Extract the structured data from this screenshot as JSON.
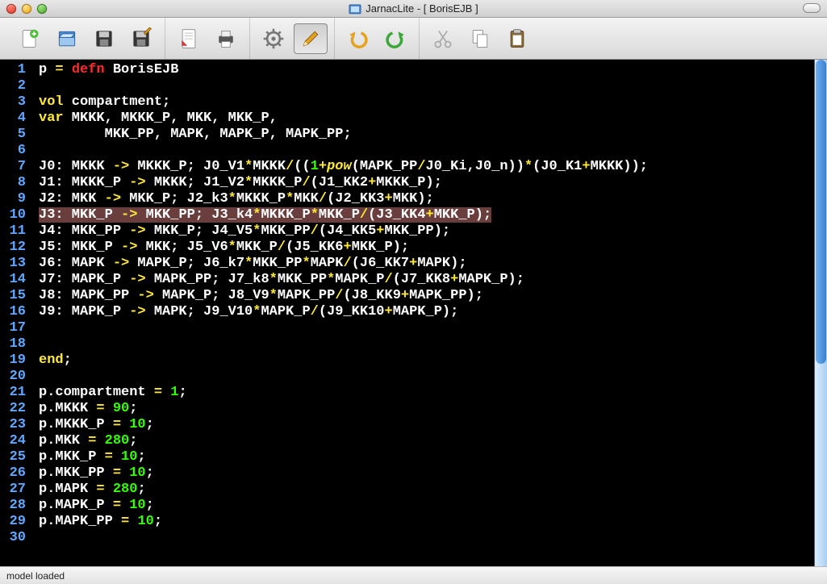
{
  "window": {
    "title": "JarnacLite - [ BorisEJB ]"
  },
  "toolbar": {
    "new_icon": "new-document-icon",
    "open_icon": "open-icon",
    "save_icon": "save-icon",
    "saveas_icon": "save-as-icon",
    "pdf_icon": "export-pdf-icon",
    "print_icon": "print-icon",
    "settings_icon": "gear-icon",
    "edit_icon": "pencil-icon",
    "undo_icon": "undo-icon",
    "redo_icon": "redo-icon",
    "cut_icon": "scissors-icon",
    "copy_icon": "copy-icon",
    "paste_icon": "paste-icon"
  },
  "status": {
    "text": "model loaded"
  },
  "editor": {
    "highlighted_line": 10,
    "lines": [
      {
        "n": 1,
        "tokens": [
          {
            "t": "p ",
            "c": "txt"
          },
          {
            "t": "=",
            "c": "op"
          },
          {
            "t": " ",
            "c": "txt"
          },
          {
            "t": "defn",
            "c": "kw-def"
          },
          {
            "t": " BorisEJB",
            "c": "txt"
          }
        ]
      },
      {
        "n": 2,
        "tokens": []
      },
      {
        "n": 3,
        "tokens": [
          {
            "t": "vol",
            "c": "kw-vol"
          },
          {
            "t": " compartment;",
            "c": "txt"
          }
        ]
      },
      {
        "n": 4,
        "tokens": [
          {
            "t": "var",
            "c": "kw-var"
          },
          {
            "t": " MKKK, MKKK_P, MKK, MKK_P,",
            "c": "txt"
          }
        ]
      },
      {
        "n": 5,
        "tokens": [
          {
            "t": "        MKK_PP, MAPK, MAPK_P, MAPK_PP;",
            "c": "txt"
          }
        ]
      },
      {
        "n": 6,
        "tokens": []
      },
      {
        "n": 7,
        "tokens": [
          {
            "t": "J0: MKKK ",
            "c": "txt"
          },
          {
            "t": "->",
            "c": "op"
          },
          {
            "t": " MKKK_P; J0_V1",
            "c": "txt"
          },
          {
            "t": "*",
            "c": "op"
          },
          {
            "t": "MKKK",
            "c": "txt"
          },
          {
            "t": "/",
            "c": "op"
          },
          {
            "t": "((",
            "c": "txt"
          },
          {
            "t": "1",
            "c": "num"
          },
          {
            "t": "+",
            "c": "op"
          },
          {
            "t": "pow",
            "c": "kw-pow"
          },
          {
            "t": "(MAPK_PP",
            "c": "txt"
          },
          {
            "t": "/",
            "c": "op"
          },
          {
            "t": "J0_Ki,J0_n))",
            "c": "txt"
          },
          {
            "t": "*",
            "c": "op"
          },
          {
            "t": "(J0_K1",
            "c": "txt"
          },
          {
            "t": "+",
            "c": "op"
          },
          {
            "t": "MKKK));",
            "c": "txt"
          }
        ]
      },
      {
        "n": 8,
        "tokens": [
          {
            "t": "J1: MKKK_P ",
            "c": "txt"
          },
          {
            "t": "->",
            "c": "op"
          },
          {
            "t": " MKKK; J1_V2",
            "c": "txt"
          },
          {
            "t": "*",
            "c": "op"
          },
          {
            "t": "MKKK_P",
            "c": "txt"
          },
          {
            "t": "/",
            "c": "op"
          },
          {
            "t": "(J1_KK2",
            "c": "txt"
          },
          {
            "t": "+",
            "c": "op"
          },
          {
            "t": "MKKK_P);",
            "c": "txt"
          }
        ]
      },
      {
        "n": 9,
        "tokens": [
          {
            "t": "J2: MKK ",
            "c": "txt"
          },
          {
            "t": "->",
            "c": "op"
          },
          {
            "t": " MKK_P; J2_k3",
            "c": "txt"
          },
          {
            "t": "*",
            "c": "op"
          },
          {
            "t": "MKKK_P",
            "c": "txt"
          },
          {
            "t": "*",
            "c": "op"
          },
          {
            "t": "MKK",
            "c": "txt"
          },
          {
            "t": "/",
            "c": "op"
          },
          {
            "t": "(J2_KK3",
            "c": "txt"
          },
          {
            "t": "+",
            "c": "op"
          },
          {
            "t": "MKK);",
            "c": "txt"
          }
        ]
      },
      {
        "n": 10,
        "tokens": [
          {
            "t": "J3: MKK_P ",
            "c": "txt"
          },
          {
            "t": "->",
            "c": "op"
          },
          {
            "t": " MKK_PP; J3_k4",
            "c": "txt"
          },
          {
            "t": "*",
            "c": "op"
          },
          {
            "t": "MKKK_P",
            "c": "txt"
          },
          {
            "t": "*",
            "c": "op"
          },
          {
            "t": "MKK_P",
            "c": "txt"
          },
          {
            "t": "/",
            "c": "op"
          },
          {
            "t": "(J3_KK4",
            "c": "txt"
          },
          {
            "t": "+",
            "c": "op"
          },
          {
            "t": "MKK_P);",
            "c": "txt"
          }
        ]
      },
      {
        "n": 11,
        "tokens": [
          {
            "t": "J4: MKK_PP ",
            "c": "txt"
          },
          {
            "t": "->",
            "c": "op"
          },
          {
            "t": " MKK_P; J4_V5",
            "c": "txt"
          },
          {
            "t": "*",
            "c": "op"
          },
          {
            "t": "MKK_PP",
            "c": "txt"
          },
          {
            "t": "/",
            "c": "op"
          },
          {
            "t": "(J4_KK5",
            "c": "txt"
          },
          {
            "t": "+",
            "c": "op"
          },
          {
            "t": "MKK_PP);",
            "c": "txt"
          }
        ]
      },
      {
        "n": 12,
        "tokens": [
          {
            "t": "J5: MKK_P ",
            "c": "txt"
          },
          {
            "t": "->",
            "c": "op"
          },
          {
            "t": " MKK; J5_V6",
            "c": "txt"
          },
          {
            "t": "*",
            "c": "op"
          },
          {
            "t": "MKK_P",
            "c": "txt"
          },
          {
            "t": "/",
            "c": "op"
          },
          {
            "t": "(J5_KK6",
            "c": "txt"
          },
          {
            "t": "+",
            "c": "op"
          },
          {
            "t": "MKK_P);",
            "c": "txt"
          }
        ]
      },
      {
        "n": 13,
        "tokens": [
          {
            "t": "J6: MAPK ",
            "c": "txt"
          },
          {
            "t": "->",
            "c": "op"
          },
          {
            "t": " MAPK_P; J6_k7",
            "c": "txt"
          },
          {
            "t": "*",
            "c": "op"
          },
          {
            "t": "MKK_PP",
            "c": "txt"
          },
          {
            "t": "*",
            "c": "op"
          },
          {
            "t": "MAPK",
            "c": "txt"
          },
          {
            "t": "/",
            "c": "op"
          },
          {
            "t": "(J6_KK7",
            "c": "txt"
          },
          {
            "t": "+",
            "c": "op"
          },
          {
            "t": "MAPK);",
            "c": "txt"
          }
        ]
      },
      {
        "n": 14,
        "tokens": [
          {
            "t": "J7: MAPK_P ",
            "c": "txt"
          },
          {
            "t": "->",
            "c": "op"
          },
          {
            "t": " MAPK_PP; J7_k8",
            "c": "txt"
          },
          {
            "t": "*",
            "c": "op"
          },
          {
            "t": "MKK_PP",
            "c": "txt"
          },
          {
            "t": "*",
            "c": "op"
          },
          {
            "t": "MAPK_P",
            "c": "txt"
          },
          {
            "t": "/",
            "c": "op"
          },
          {
            "t": "(J7_KK8",
            "c": "txt"
          },
          {
            "t": "+",
            "c": "op"
          },
          {
            "t": "MAPK_P);",
            "c": "txt"
          }
        ]
      },
      {
        "n": 15,
        "tokens": [
          {
            "t": "J8: MAPK_PP ",
            "c": "txt"
          },
          {
            "t": "->",
            "c": "op"
          },
          {
            "t": " MAPK_P; J8_V9",
            "c": "txt"
          },
          {
            "t": "*",
            "c": "op"
          },
          {
            "t": "MAPK_PP",
            "c": "txt"
          },
          {
            "t": "/",
            "c": "op"
          },
          {
            "t": "(J8_KK9",
            "c": "txt"
          },
          {
            "t": "+",
            "c": "op"
          },
          {
            "t": "MAPK_PP);",
            "c": "txt"
          }
        ]
      },
      {
        "n": 16,
        "tokens": [
          {
            "t": "J9: MAPK_P ",
            "c": "txt"
          },
          {
            "t": "->",
            "c": "op"
          },
          {
            "t": " MAPK; J9_V10",
            "c": "txt"
          },
          {
            "t": "*",
            "c": "op"
          },
          {
            "t": "MAPK_P",
            "c": "txt"
          },
          {
            "t": "/",
            "c": "op"
          },
          {
            "t": "(J9_KK10",
            "c": "txt"
          },
          {
            "t": "+",
            "c": "op"
          },
          {
            "t": "MAPK_P);",
            "c": "txt"
          }
        ]
      },
      {
        "n": 17,
        "tokens": []
      },
      {
        "n": 18,
        "tokens": []
      },
      {
        "n": 19,
        "tokens": [
          {
            "t": "end",
            "c": "kw-end"
          },
          {
            "t": ";",
            "c": "txt"
          }
        ]
      },
      {
        "n": 20,
        "tokens": []
      },
      {
        "n": 21,
        "tokens": [
          {
            "t": "p.compartment ",
            "c": "txt"
          },
          {
            "t": "=",
            "c": "op"
          },
          {
            "t": " ",
            "c": "txt"
          },
          {
            "t": "1",
            "c": "num"
          },
          {
            "t": ";",
            "c": "txt"
          }
        ]
      },
      {
        "n": 22,
        "tokens": [
          {
            "t": "p.MKKK ",
            "c": "txt"
          },
          {
            "t": "=",
            "c": "op"
          },
          {
            "t": " ",
            "c": "txt"
          },
          {
            "t": "90",
            "c": "num"
          },
          {
            "t": ";",
            "c": "txt"
          }
        ]
      },
      {
        "n": 23,
        "tokens": [
          {
            "t": "p.MKKK_P ",
            "c": "txt"
          },
          {
            "t": "=",
            "c": "op"
          },
          {
            "t": " ",
            "c": "txt"
          },
          {
            "t": "10",
            "c": "num"
          },
          {
            "t": ";",
            "c": "txt"
          }
        ]
      },
      {
        "n": 24,
        "tokens": [
          {
            "t": "p.MKK ",
            "c": "txt"
          },
          {
            "t": "=",
            "c": "op"
          },
          {
            "t": " ",
            "c": "txt"
          },
          {
            "t": "280",
            "c": "num"
          },
          {
            "t": ";",
            "c": "txt"
          }
        ]
      },
      {
        "n": 25,
        "tokens": [
          {
            "t": "p.MKK_P ",
            "c": "txt"
          },
          {
            "t": "=",
            "c": "op"
          },
          {
            "t": " ",
            "c": "txt"
          },
          {
            "t": "10",
            "c": "num"
          },
          {
            "t": ";",
            "c": "txt"
          }
        ]
      },
      {
        "n": 26,
        "tokens": [
          {
            "t": "p.MKK_PP ",
            "c": "txt"
          },
          {
            "t": "=",
            "c": "op"
          },
          {
            "t": " ",
            "c": "txt"
          },
          {
            "t": "10",
            "c": "num"
          },
          {
            "t": ";",
            "c": "txt"
          }
        ]
      },
      {
        "n": 27,
        "tokens": [
          {
            "t": "p.MAPK ",
            "c": "txt"
          },
          {
            "t": "=",
            "c": "op"
          },
          {
            "t": " ",
            "c": "txt"
          },
          {
            "t": "280",
            "c": "num"
          },
          {
            "t": ";",
            "c": "txt"
          }
        ]
      },
      {
        "n": 28,
        "tokens": [
          {
            "t": "p.MAPK_P ",
            "c": "txt"
          },
          {
            "t": "=",
            "c": "op"
          },
          {
            "t": " ",
            "c": "txt"
          },
          {
            "t": "10",
            "c": "num"
          },
          {
            "t": ";",
            "c": "txt"
          }
        ]
      },
      {
        "n": 29,
        "tokens": [
          {
            "t": "p.MAPK_PP ",
            "c": "txt"
          },
          {
            "t": "=",
            "c": "op"
          },
          {
            "t": " ",
            "c": "txt"
          },
          {
            "t": "10",
            "c": "num"
          },
          {
            "t": ";",
            "c": "txt"
          }
        ]
      },
      {
        "n": 30,
        "tokens": []
      }
    ]
  }
}
